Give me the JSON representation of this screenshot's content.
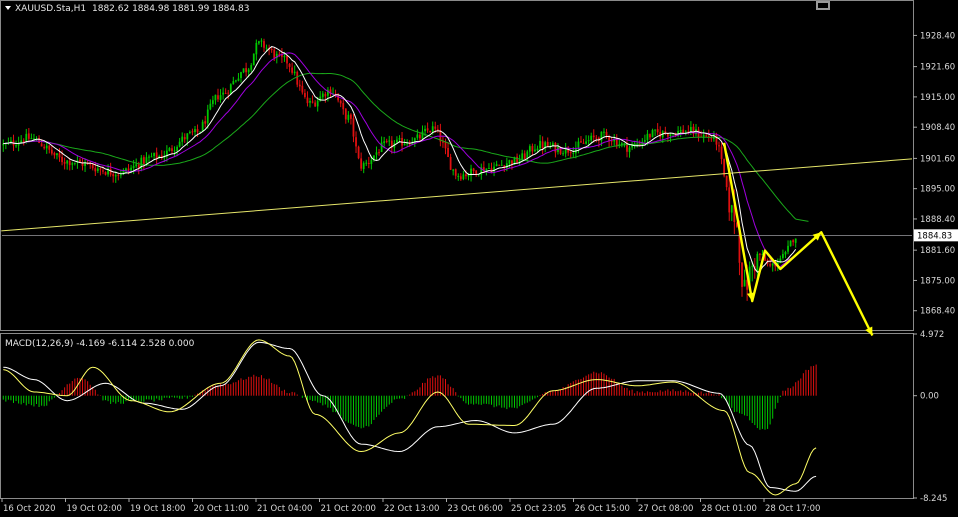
{
  "chart_header": {
    "symbol_label": "XAUUSD.Sta,H1",
    "ohlc": "1882.62 1884.98 1881.99 1884.83"
  },
  "macd_header": "MACD(12,26,9) -4.169 -6.114 2.528 0.000",
  "current_price_label": "1884.83",
  "colors": {
    "background": "#000000",
    "bull": "#00c800",
    "bear": "#e01010",
    "signal": "#ffffff",
    "ma_fast": "#ffffff",
    "ma_mid": "#a000e0",
    "ma_slow": "#1aa81a",
    "trendline": "#e6e66a",
    "arrow": "#ffff00",
    "macd_line": "#ffff66",
    "grid_text": "#d8d8d8"
  },
  "icons": {
    "menu": "triangle-down-icon",
    "window": "window-icon"
  },
  "chart_data": [
    {
      "type": "candlestick",
      "title": "XAUUSD.Sta,H1",
      "ylim": [
        1864.2,
        1935.9
      ],
      "y_ticks": [
        "1928.40",
        "1921.60",
        "1915.00",
        "1908.40",
        "1901.60",
        "1895.00",
        "1888.40",
        "1881.60",
        "1875.00",
        "1868.40"
      ],
      "y_tick_values": [
        1928.4,
        1921.6,
        1915.0,
        1908.4,
        1901.6,
        1895.0,
        1888.4,
        1881.6,
        1875.0,
        1868.4
      ],
      "x_ticks": [
        "16 Oct 2020",
        "19 Oct 02:00",
        "19 Oct 18:00",
        "20 Oct 11:00",
        "21 Oct 04:00",
        "21 Oct 20:00",
        "22 Oct 13:00",
        "23 Oct 06:00",
        "25 Oct 23:05",
        "26 Oct 15:00",
        "27 Oct 08:00",
        "28 Oct 01:00",
        "28 Oct 17:00"
      ],
      "price_anchors": [
        {
          "bar": 0,
          "price": 1904.5
        },
        {
          "bar": 10,
          "price": 1906.0
        },
        {
          "bar": 25,
          "price": 1901.0
        },
        {
          "bar": 45,
          "price": 1898.5
        },
        {
          "bar": 60,
          "price": 1902.0
        },
        {
          "bar": 75,
          "price": 1907.0
        },
        {
          "bar": 85,
          "price": 1915.5
        },
        {
          "bar": 95,
          "price": 1921.0
        },
        {
          "bar": 100,
          "price": 1926.5
        },
        {
          "bar": 110,
          "price": 1923.0
        },
        {
          "bar": 120,
          "price": 1913.5
        },
        {
          "bar": 128,
          "price": 1916.5
        },
        {
          "bar": 135,
          "price": 1910.5
        },
        {
          "bar": 140,
          "price": 1900.0
        },
        {
          "bar": 150,
          "price": 1904.5
        },
        {
          "bar": 160,
          "price": 1905.5
        },
        {
          "bar": 168,
          "price": 1908.0
        },
        {
          "bar": 178,
          "price": 1898.0
        },
        {
          "bar": 190,
          "price": 1899.5
        },
        {
          "bar": 200,
          "price": 1901.0
        },
        {
          "bar": 210,
          "price": 1904.5
        },
        {
          "bar": 220,
          "price": 1903.5
        },
        {
          "bar": 235,
          "price": 1906.5
        },
        {
          "bar": 245,
          "price": 1904.0
        },
        {
          "bar": 255,
          "price": 1907.0
        },
        {
          "bar": 268,
          "price": 1907.5
        },
        {
          "bar": 278,
          "price": 1906.0
        },
        {
          "bar": 286,
          "price": 1889.0
        },
        {
          "bar": 290,
          "price": 1873.0
        },
        {
          "bar": 293,
          "price": 1878.0
        },
        {
          "bar": 296,
          "price": 1880.5
        },
        {
          "bar": 300,
          "price": 1878.0
        },
        {
          "bar": 305,
          "price": 1880.0
        },
        {
          "bar": 310,
          "price": 1884.8
        }
      ],
      "current_price": 1884.83,
      "trendline": {
        "from": {
          "bar": 0,
          "price": 1885.8
        },
        "to": {
          "bar": 355,
          "price": 1901.5
        }
      },
      "overlays": [
        {
          "name": "MA fast",
          "color": "#ffffff",
          "period": 8
        },
        {
          "name": "MA mid",
          "color": "#a000e0",
          "period": 16
        },
        {
          "name": "MA slow",
          "color": "#1aa81a",
          "period": 40
        }
      ],
      "yellow_path": [
        {
          "bar": 282,
          "price": 1905.0
        },
        {
          "bar": 293,
          "price": 1870.5
        },
        {
          "bar": 298,
          "price": 1881.5
        },
        {
          "bar": 304,
          "price": 1877.5
        },
        {
          "bar": 320,
          "price": 1885.5
        },
        {
          "bar": 340,
          "price": 1863.0
        }
      ]
    },
    {
      "type": "bar",
      "title": "MACD(12,26,9) -4.169 -6.114 2.528 0.000",
      "ylim": [
        -8.245,
        4.972
      ],
      "y_ticks": [
        "4.972",
        "0.00",
        "-8.245"
      ],
      "y_tick_values": [
        4.972,
        0.0,
        -8.245
      ],
      "histogram_anchors": [
        {
          "bar": 0,
          "value": -0.4
        },
        {
          "bar": 15,
          "value": -0.8
        },
        {
          "bar": 30,
          "value": 1.5
        },
        {
          "bar": 42,
          "value": -0.6
        },
        {
          "bar": 55,
          "value": -0.4
        },
        {
          "bar": 70,
          "value": -0.2
        },
        {
          "bar": 85,
          "value": 0.9
        },
        {
          "bar": 100,
          "value": 1.6
        },
        {
          "bar": 112,
          "value": 0.3
        },
        {
          "bar": 122,
          "value": -0.5
        },
        {
          "bar": 140,
          "value": -2.6
        },
        {
          "bar": 155,
          "value": -0.3
        },
        {
          "bar": 170,
          "value": 1.6
        },
        {
          "bar": 182,
          "value": -0.6
        },
        {
          "bar": 200,
          "value": -1.0
        },
        {
          "bar": 215,
          "value": 0.4
        },
        {
          "bar": 232,
          "value": 1.9
        },
        {
          "bar": 248,
          "value": 0.3
        },
        {
          "bar": 262,
          "value": 0.4
        },
        {
          "bar": 278,
          "value": 0.2
        },
        {
          "bar": 288,
          "value": -1.4
        },
        {
          "bar": 298,
          "value": -2.8
        },
        {
          "bar": 306,
          "value": 0.5
        },
        {
          "bar": 318,
          "value": 2.5
        }
      ],
      "signal_anchors": [
        {
          "bar": 0,
          "value": 2.3
        },
        {
          "bar": 12,
          "value": 1.3
        },
        {
          "bar": 25,
          "value": -0.4
        },
        {
          "bar": 40,
          "value": 1.0
        },
        {
          "bar": 55,
          "value": -0.6
        },
        {
          "bar": 70,
          "value": -1.1
        },
        {
          "bar": 85,
          "value": 0.8
        },
        {
          "bar": 100,
          "value": 4.3
        },
        {
          "bar": 112,
          "value": 3.8
        },
        {
          "bar": 125,
          "value": 0.0
        },
        {
          "bar": 140,
          "value": -3.9
        },
        {
          "bar": 155,
          "value": -4.5
        },
        {
          "bar": 170,
          "value": -2.5
        },
        {
          "bar": 185,
          "value": -2.0
        },
        {
          "bar": 200,
          "value": -3.0
        },
        {
          "bar": 215,
          "value": -2.3
        },
        {
          "bar": 232,
          "value": 0.6
        },
        {
          "bar": 248,
          "value": 1.2
        },
        {
          "bar": 262,
          "value": 1.2
        },
        {
          "bar": 280,
          "value": 0.2
        },
        {
          "bar": 292,
          "value": -4.0
        },
        {
          "bar": 300,
          "value": -7.4
        },
        {
          "bar": 310,
          "value": -7.7
        },
        {
          "bar": 318,
          "value": -6.5
        }
      ],
      "macd_anchors": [
        {
          "bar": 0,
          "value": 2.1
        },
        {
          "bar": 12,
          "value": 0.3
        },
        {
          "bar": 25,
          "value": 0.0
        },
        {
          "bar": 35,
          "value": 2.3
        },
        {
          "bar": 50,
          "value": -0.4
        },
        {
          "bar": 65,
          "value": -1.3
        },
        {
          "bar": 85,
          "value": 1.0
        },
        {
          "bar": 100,
          "value": 4.5
        },
        {
          "bar": 112,
          "value": 3.2
        },
        {
          "bar": 122,
          "value": -1.5
        },
        {
          "bar": 140,
          "value": -4.5
        },
        {
          "bar": 155,
          "value": -3.0
        },
        {
          "bar": 170,
          "value": 0.3
        },
        {
          "bar": 182,
          "value": -2.3
        },
        {
          "bar": 200,
          "value": -2.4
        },
        {
          "bar": 215,
          "value": 0.4
        },
        {
          "bar": 232,
          "value": 1.3
        },
        {
          "bar": 248,
          "value": 0.8
        },
        {
          "bar": 262,
          "value": 1.1
        },
        {
          "bar": 282,
          "value": -1.2
        },
        {
          "bar": 292,
          "value": -6.2
        },
        {
          "bar": 302,
          "value": -8.0
        },
        {
          "bar": 310,
          "value": -7.1
        },
        {
          "bar": 318,
          "value": -4.2
        }
      ]
    }
  ]
}
